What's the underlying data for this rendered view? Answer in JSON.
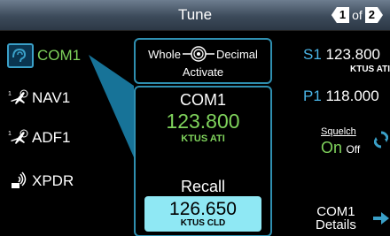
{
  "header": {
    "title": "Tune",
    "page_current": "1",
    "page_of": "of",
    "page_total": "2"
  },
  "radios": [
    {
      "label": "COM1",
      "icon": "com-headset-icon",
      "selected": true
    },
    {
      "label": "NAV1",
      "icon": "nav-plane-icon",
      "selected": false
    },
    {
      "label": "ADF1",
      "icon": "adf-plane-icon",
      "selected": false
    },
    {
      "label": "XPDR",
      "icon": "xpdr-signal-icon",
      "selected": false
    }
  ],
  "knob": {
    "whole_label": "Whole",
    "decimal_label": "Decimal",
    "activate_label": "Activate",
    "icon": "dual-knob-icon"
  },
  "active": {
    "name": "COM1",
    "frequency": "123.800",
    "identifier": "KTUS ATI",
    "recall_label": "Recall",
    "recall_frequency": "126.650",
    "recall_identifier": "KTUS CLD"
  },
  "presets": {
    "s1": {
      "label": "S1",
      "frequency": "123.800",
      "identifier": "KTUS ATI"
    },
    "p1": {
      "label": "P1",
      "frequency": "118.000"
    }
  },
  "squelch": {
    "label": "Squelch",
    "on_label": "On",
    "off_label": "Off"
  },
  "details": {
    "line1": "COM1",
    "line2": "Details"
  },
  "colors": {
    "accent_green": "#7fd35c",
    "accent_blue": "#2f8fb0",
    "recall_bg": "#8fe8f4",
    "header_bg": "#4a5868"
  }
}
